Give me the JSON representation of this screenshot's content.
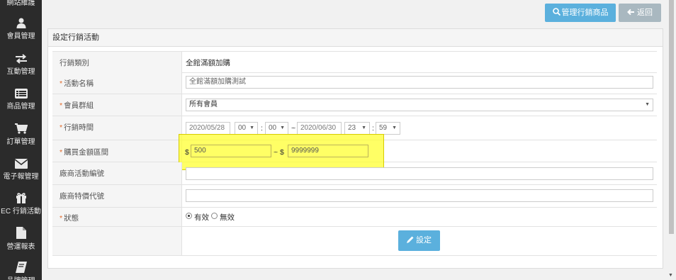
{
  "sidebar": {
    "items": [
      {
        "label": "網站維護",
        "icon": "wrench-icon"
      },
      {
        "label": "會員管理",
        "icon": "user-icon"
      },
      {
        "label": "互動管理",
        "icon": "exchange-icon"
      },
      {
        "label": "商品管理",
        "icon": "list-icon"
      },
      {
        "label": "訂單管理",
        "icon": "cart-icon"
      },
      {
        "label": "電子報管理",
        "icon": "envelope-icon"
      },
      {
        "label": "EC 行銷活動",
        "icon": "gift-icon"
      },
      {
        "label": "營運報表",
        "icon": "file-icon"
      },
      {
        "label": "品牌管理",
        "icon": "book-icon"
      }
    ]
  },
  "toolbar": {
    "manage_label": "管理行銷商品",
    "back_label": "返回"
  },
  "panel": {
    "title": "設定行銷活動"
  },
  "form": {
    "type_label": "行銷類別",
    "type_value": "全館滿額加購",
    "name_label": "活動名稱",
    "name_value": "全館滿額加購測試",
    "group_label": "會員群組",
    "group_value": "所有會員",
    "time_label": "行銷時間",
    "start_date": "2020/05/28",
    "start_hour": "00",
    "start_min": "00",
    "time_colon": ":",
    "time_tilde": "~",
    "end_date": "2020/06/30",
    "end_hour": "23",
    "end_min": "59",
    "amount_label": "購買金額區間",
    "currency": "$",
    "amount_min": "500",
    "amount_sep": "~ $",
    "amount_max": "9999999",
    "vendor_label": "廠商活動編號",
    "vendor_value": "",
    "promo_label": "廠商特價代號",
    "promo_value": "",
    "status_label": "狀態",
    "status_active": "有效",
    "status_inactive": "無效",
    "status_selected": "有效",
    "required_mark": "*",
    "submit_label": "設定"
  },
  "colors": {
    "sidebar_bg": "#2b2b2b",
    "primary": "#5bb0dd",
    "secondary": "#a9b8c0",
    "highlight": "#ffff33",
    "required": "#e06a2c"
  }
}
